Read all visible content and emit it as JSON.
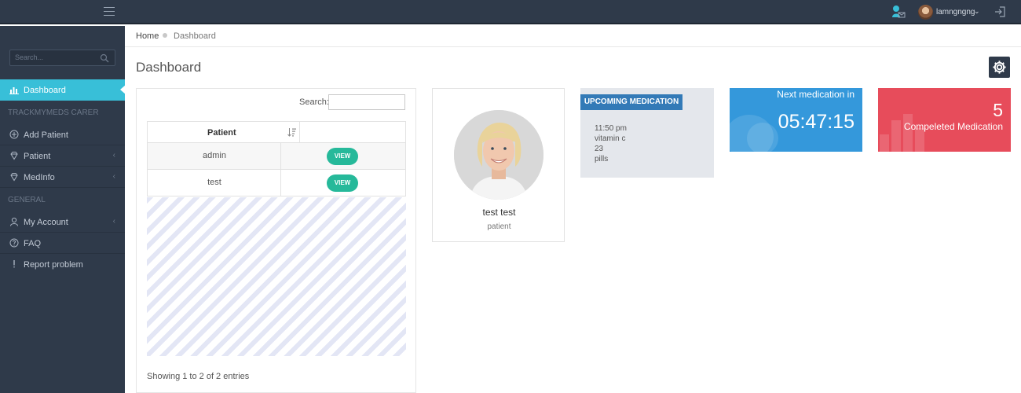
{
  "topbar": {
    "user_name": "lamngngng",
    "user_caret": "⌄"
  },
  "sidebar": {
    "search_placeholder": "Search...",
    "sections": {
      "carer": "TRACKMYMEDS CARER",
      "general": "GENERAL"
    },
    "items": [
      {
        "label": "Dashboard",
        "icon": "bar-chart-icon",
        "active": true
      },
      {
        "label": "Add Patient",
        "icon": "plus-circle-icon"
      },
      {
        "label": "Patient",
        "icon": "diamond-icon",
        "has_arrow": true
      },
      {
        "label": "MedInfo",
        "icon": "diamond-icon",
        "has_arrow": true
      },
      {
        "label": "My Account",
        "icon": "user-icon",
        "has_arrow": true
      },
      {
        "label": "FAQ",
        "icon": "question-icon"
      },
      {
        "label": "Report problem",
        "icon": "exclamation-icon"
      }
    ],
    "arrow": "‹"
  },
  "breadcrumb": {
    "home": "Home",
    "current": "Dashboard"
  },
  "page": {
    "title": "Dashboard"
  },
  "patient_table": {
    "search_label": "Search:",
    "search_value": "",
    "column": "Patient",
    "rows": [
      {
        "name": "admin",
        "action": "VIEW"
      },
      {
        "name": "test",
        "action": "VIEW"
      }
    ],
    "footer": "Showing 1 to 2 of 2 entries"
  },
  "profile": {
    "name": "test test",
    "role": "patient"
  },
  "upcoming": {
    "title": "UPCOMING MEDICATION",
    "time": "11:50 pm",
    "medicine": "vitamin c",
    "amount": "23",
    "unit": "pills"
  },
  "next_tile": {
    "label": "Next medication in",
    "countdown": "05:47:15"
  },
  "done_tile": {
    "count": "5",
    "label": "Compeleted Medication"
  },
  "colors": {
    "sidebar": "#2f3a4a",
    "active": "#38bfd8",
    "view_button": "#26b99a",
    "upcoming_badge": "#337ab7",
    "next_tile": "#3498db",
    "done_tile": "#e74c5b"
  }
}
